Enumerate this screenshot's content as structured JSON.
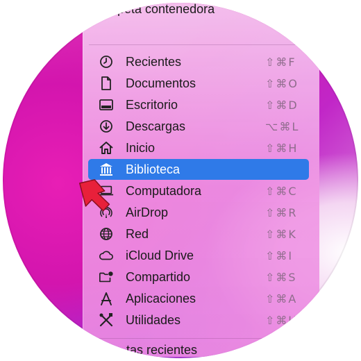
{
  "menu": {
    "top_item": {
      "label": "Carpeta contenedora",
      "shortcut": "⌘"
    },
    "items": [
      {
        "label": "Recientes",
        "shortcut": "⇧⌘F",
        "icon": "clock-icon"
      },
      {
        "label": "Documentos",
        "shortcut": "⇧⌘O",
        "icon": "document-icon"
      },
      {
        "label": "Escritorio",
        "shortcut": "⇧⌘D",
        "icon": "desktop-icon"
      },
      {
        "label": "Descargas",
        "shortcut": "⌥⌘L",
        "icon": "download-icon"
      },
      {
        "label": "Inicio",
        "shortcut": "⇧⌘H",
        "icon": "home-icon"
      },
      {
        "label": "Biblioteca",
        "shortcut": "",
        "icon": "library-icon",
        "selected": true
      },
      {
        "label": "Computadora",
        "shortcut": "⇧⌘C",
        "icon": "laptop-icon"
      },
      {
        "label": "AirDrop",
        "shortcut": "⇧⌘R",
        "icon": "airdrop-icon"
      },
      {
        "label": "Red",
        "shortcut": "⇧⌘K",
        "icon": "globe-icon"
      },
      {
        "label": "iCloud Drive",
        "shortcut": "⇧⌘I",
        "icon": "cloud-icon"
      },
      {
        "label": "Compartido",
        "shortcut": "⇧⌘S",
        "icon": "shared-folder-icon"
      },
      {
        "label": "Aplicaciones",
        "shortcut": "⇧⌘A",
        "icon": "applications-icon"
      },
      {
        "label": "Utilidades",
        "shortcut": "⇧⌘U",
        "icon": "utilities-icon"
      }
    ],
    "bottom_item": {
      "label": "tas recientes"
    }
  },
  "colors": {
    "selection": "#2f7ae8",
    "pointer_arrow": "#e8203a"
  }
}
